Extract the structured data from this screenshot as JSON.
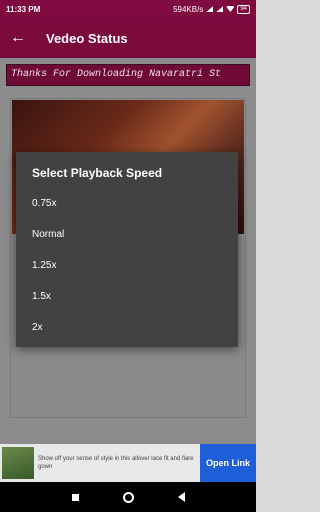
{
  "status_bar": {
    "time": "11:33 PM",
    "network_speed": "594KB/s",
    "battery": "94"
  },
  "toolbar": {
    "title": "Vedeo Status"
  },
  "marquee": {
    "text": "Thanks For Downloading Navaratri St"
  },
  "dialog": {
    "title": "Select Playback Speed",
    "options": [
      "0.75x",
      "Normal",
      "1.25x",
      "1.5x",
      "2x"
    ]
  },
  "ad": {
    "text": "Show off your sense of style in this allover lace fit and flare gown",
    "button": "Open Link"
  },
  "icons": {
    "back": "arrow-left-icon",
    "recent_apps": "square-icon",
    "home": "circle-icon",
    "nav_back": "triangle-back-icon"
  }
}
